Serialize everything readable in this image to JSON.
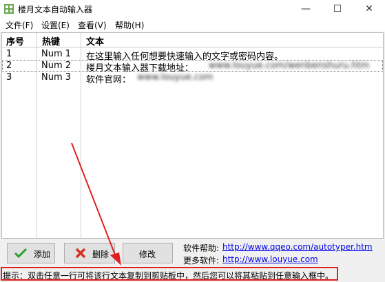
{
  "window": {
    "title": "楼月文本自动输入器",
    "minimize_glyph": "—",
    "maximize_glyph": "☐",
    "close_glyph": "✕"
  },
  "menu": [
    "文件(F)",
    "设置(E)",
    "查看(V)",
    "帮助(H)"
  ],
  "table": {
    "headers": [
      "序号",
      "热键",
      "文本"
    ],
    "rows": [
      {
        "index": "1",
        "hotkey": "Num 1",
        "text": "在这里输入任何想要快速输入的文字或密码内容。"
      },
      {
        "index": "2",
        "hotkey": "Num 2",
        "text": "楼月文本输入器下载地址：",
        "text_blurred": "www.louyue.com/wenbenshuru.htm"
      },
      {
        "index": "3",
        "hotkey": "Num 3",
        "text": "软件官网：",
        "text_blurred": "www.louyue.com"
      }
    ]
  },
  "buttons": {
    "add": "添加",
    "delete": "删除",
    "modify": "修改"
  },
  "help": {
    "software_help_label": "软件帮助:",
    "software_help_url": "http://www.qqeo.com/autotyper.htm",
    "more_software_label": "更多软件:",
    "more_software_url": "http://www.louyue.com"
  },
  "status": "提示：双击任意一行可将该行文本复制到剪贴板中，然后您可以将其粘贴到任意输入框中。",
  "colors": {
    "annotation": "#e02020",
    "link": "#0000ee",
    "add_icon": "#2e9e2e",
    "delete_icon": "#d83020"
  }
}
